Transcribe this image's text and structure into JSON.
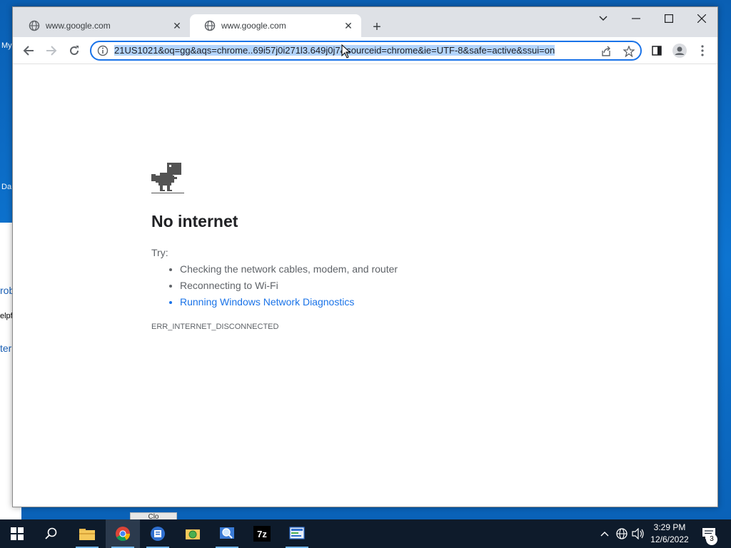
{
  "desktop": {
    "behind_texts": [
      "My",
      "rob",
      "elpf",
      "ter",
      "Da"
    ],
    "ghost_button": "Clo"
  },
  "browser": {
    "tabs": [
      {
        "title": "www.google.com",
        "active": false
      },
      {
        "title": "www.google.com",
        "active": true
      }
    ],
    "url_display": "21US1021&oq=gg&aqs=chrome..69i57j0i271l3.649j0j7&sourceid=chrome&ie=UTF-8&safe=active&ssui=on"
  },
  "page": {
    "title": "No internet",
    "try_label": "Try:",
    "suggestions": [
      {
        "text": "Checking the network cables, modem, and router",
        "link": false
      },
      {
        "text": "Reconnecting to Wi-Fi",
        "link": false
      },
      {
        "text": "Running Windows Network Diagnostics",
        "link": true
      }
    ],
    "error_code": "ERR_INTERNET_DISCONNECTED"
  },
  "taskbar": {
    "apps": [
      "start-icon",
      "search-icon",
      "file-explorer-icon",
      "chrome-icon",
      "app-blue-icon",
      "app-folder-search-icon",
      "app-magnifier-icon",
      "7zip-icon",
      "app-screen-icon"
    ],
    "time": "3:29 PM",
    "date": "12/6/2022",
    "notifications": "3"
  },
  "colors": {
    "accent": "#1a73e8",
    "taskbar": "#0e1b2b",
    "desktop": "#0a6fc2"
  }
}
